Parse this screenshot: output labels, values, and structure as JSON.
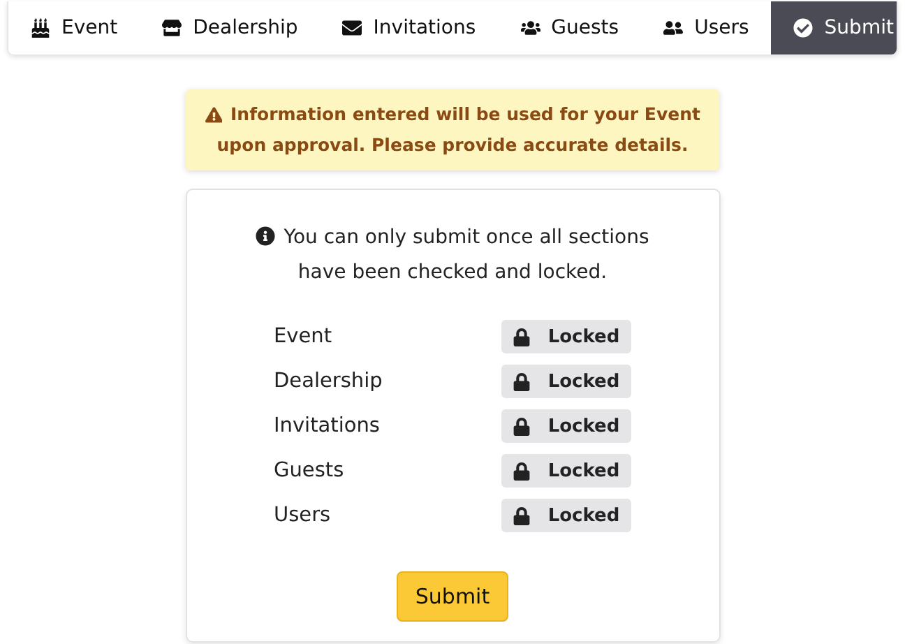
{
  "tabs": [
    {
      "label": "Event",
      "selected": false
    },
    {
      "label": "Dealership",
      "selected": false
    },
    {
      "label": "Invitations",
      "selected": false
    },
    {
      "label": "Guests",
      "selected": false
    },
    {
      "label": "Users",
      "selected": false
    },
    {
      "label": "Submit",
      "selected": true
    }
  ],
  "warning": "Information entered will be used for your Event upon approval. Please provide accurate details.",
  "info": "You can only submit once all sections have been checked and locked.",
  "sections": [
    {
      "name": "Event",
      "status": "Locked",
      "locked": true
    },
    {
      "name": "Dealership",
      "status": "Locked",
      "locked": true
    },
    {
      "name": "Invitations",
      "status": "Locked",
      "locked": true
    },
    {
      "name": "Guests",
      "status": "Locked",
      "locked": true
    },
    {
      "name": "Users",
      "status": "Locked",
      "locked": true
    }
  ],
  "submit_button": "Submit"
}
